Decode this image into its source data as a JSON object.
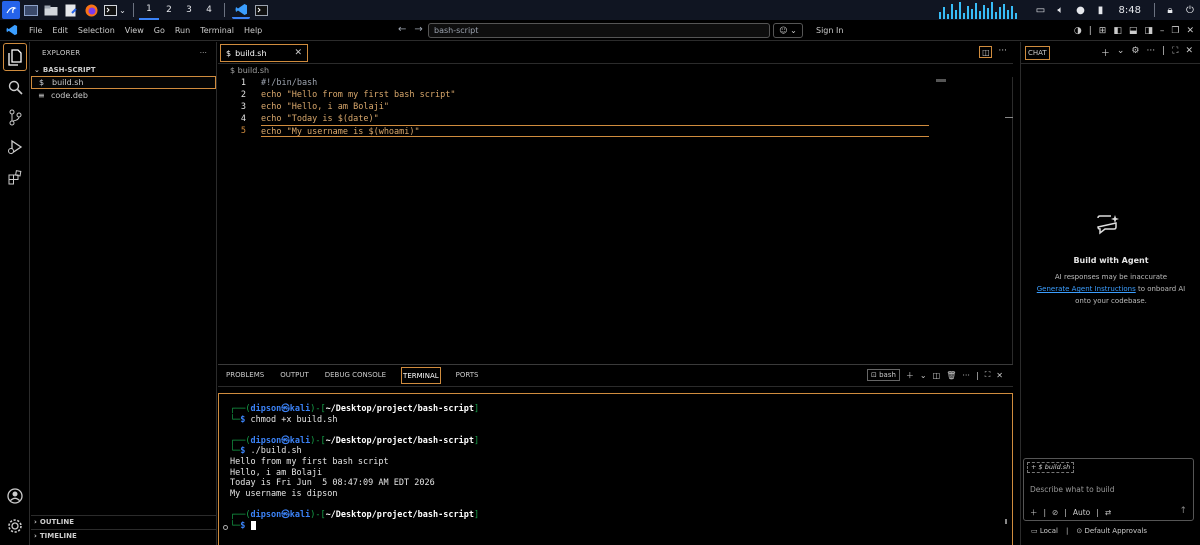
{
  "taskbar": {
    "workspaces": [
      "1",
      "2",
      "3",
      "4"
    ],
    "clock": "8:48"
  },
  "menubar": {
    "items": [
      "File",
      "Edit",
      "Selection",
      "View",
      "Go",
      "Run",
      "Terminal",
      "Help"
    ],
    "search_value": "bash-script",
    "sign_in": "Sign In"
  },
  "sidebar": {
    "title": "EXPLORER",
    "folder": "BASH-SCRIPT",
    "files": [
      {
        "icon": "$",
        "name": "build.sh"
      },
      {
        "icon": "≡",
        "name": "code.deb"
      }
    ],
    "outline": "OUTLINE",
    "timeline": "TIMELINE"
  },
  "editor": {
    "tab_icon": "$",
    "tab_label": "build.sh",
    "breadcrumb": "$ build.sh",
    "lines": [
      {
        "num": "1",
        "text": "#!/bin/bash"
      },
      {
        "num": "2",
        "text": "echo \"Hello from my first bash script\""
      },
      {
        "num": "3",
        "text": "echo \"Hello, i am Bolaji\""
      },
      {
        "num": "4",
        "text": "echo \"Today is $(date)\""
      },
      {
        "num": "5",
        "text": "echo \"My username is $(whoami)\""
      }
    ]
  },
  "panel": {
    "tabs": [
      "PROBLEMS",
      "OUTPUT",
      "DEBUG CONSOLE",
      "TERMINAL",
      "PORTS"
    ],
    "active_tab": "TERMINAL",
    "shell_label": "bash",
    "prompt_user": "dipson",
    "prompt_host": "kali",
    "prompt_dir": "~/Desktop/project/bash-script",
    "cmd1": "chmod +x build.sh",
    "cmd2": "./build.sh",
    "output": [
      "Hello from my first bash script",
      "Hello, i am Bolaji",
      "Today is Fri Jun  5 08:47:09 AM EDT 2026",
      "My username is dipson"
    ]
  },
  "chat": {
    "title": "CHAT",
    "heading": "Build with Agent",
    "desc1": "AI responses may be inaccurate",
    "link": "Generate Agent Instructions",
    "desc2": " to onboard AI",
    "desc3": "onto your codebase.",
    "context_chip": "+ $ build.sh",
    "placeholder": "Describe what to build",
    "mode": "Auto",
    "local": "Local",
    "approvals": "Default Approvals"
  },
  "colors": {
    "accent": "#d08c3e",
    "prompt_blue": "#3b82f6",
    "prompt_green": "#16a34a",
    "link": "#3b9eff"
  }
}
